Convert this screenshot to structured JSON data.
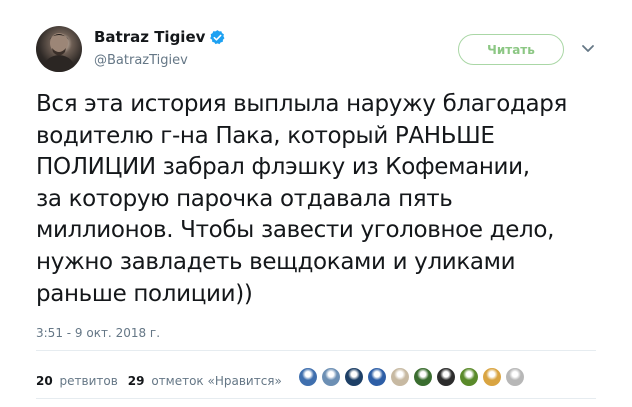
{
  "author": {
    "name": "Batraz Tigiev",
    "handle": "@BatrazTigiev",
    "verified_icon": "verified-badge-icon"
  },
  "follow_button": {
    "label": "Читать"
  },
  "menu_icon": "chevron-down-icon",
  "tweet": {
    "lines": [
      "Вся эта история выплыла наружу благодаря",
      "водителю г-на Пака, который РАНЬШЕ",
      "ПОЛИЦИИ забрал флэшку из Кофемании,",
      "за которую парочка отдавала пять",
      "миллионов. Чтобы завести уголовное дело,",
      "нужно завладеть вещдоками и уликами",
      "раньше полиции))"
    ],
    "timestamp": "3:51 - 9 окт. 2018 г."
  },
  "stats": {
    "retweets_count": "20",
    "retweets_label": "ретвитов",
    "likes_count": "29",
    "likes_label": "отметок «Нравится»"
  },
  "liker_avatars": [
    {
      "color": "#3f6fae"
    },
    {
      "color": "#6c8fb4"
    },
    {
      "color": "#1d3f66"
    },
    {
      "color": "#2d5ea6"
    },
    {
      "color": "#c7b9a2"
    },
    {
      "color": "#3a6d2f"
    },
    {
      "color": "#2c2c2c"
    },
    {
      "color": "#5a8a2a"
    },
    {
      "color": "#d9a441"
    },
    {
      "color": "#b7b7b7"
    }
  ],
  "colors": {
    "follow_border": "#aad7a6",
    "follow_text": "#8cc784",
    "verified": "#1da1f2",
    "muted_text": "#657786"
  }
}
